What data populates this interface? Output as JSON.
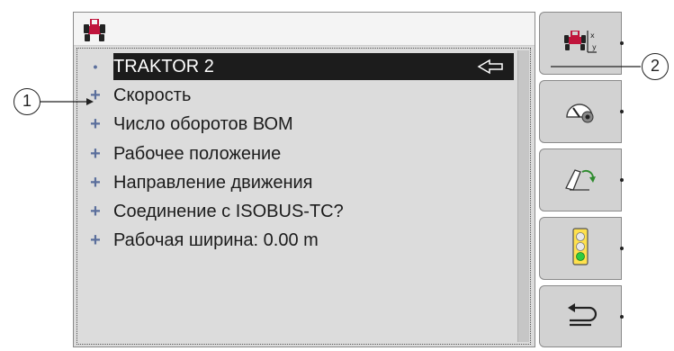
{
  "list": {
    "items": [
      {
        "bullet": "•",
        "label": "TRAKTOR 2",
        "selected": true
      },
      {
        "bullet": "+",
        "label": "Скорость"
      },
      {
        "bullet": "+",
        "label": "Число оборотов ВОМ"
      },
      {
        "bullet": "+",
        "label": "Рабочее положение"
      },
      {
        "bullet": "+",
        "label": "Направление движения"
      },
      {
        "bullet": "+",
        "label": "Соединение с ISOBUS-TC?"
      },
      {
        "bullet": "+",
        "label": "Рабочая ширина: 0.00 m"
      }
    ]
  },
  "softkeys": [
    {
      "icon": "tractor-xy-icon"
    },
    {
      "icon": "speedometer-icon"
    },
    {
      "icon": "working-position-icon"
    },
    {
      "icon": "traffic-light-icon"
    },
    {
      "icon": "back-arrow-icon"
    }
  ],
  "callouts": {
    "left": "1",
    "right": "2"
  },
  "colors": {
    "panel": "#dcdcdc",
    "selected_row": "#1c1c1c",
    "bullet": "#5b6f9c",
    "tractor_red": "#c0143c",
    "green_light": "#2ecc40"
  }
}
